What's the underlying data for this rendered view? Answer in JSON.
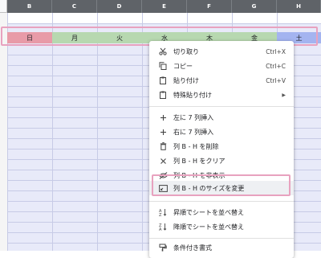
{
  "columns": [
    "B",
    "C",
    "D",
    "E",
    "F",
    "G",
    "H"
  ],
  "days": [
    {
      "label": "日",
      "kind": "sun"
    },
    {
      "label": "月",
      "kind": "wk"
    },
    {
      "label": "火",
      "kind": "wk"
    },
    {
      "label": "水",
      "kind": "wk"
    },
    {
      "label": "木",
      "kind": "wk"
    },
    {
      "label": "金",
      "kind": "wk"
    },
    {
      "label": "土",
      "kind": "sat"
    }
  ],
  "colors": {
    "column_header": "#5f6368",
    "selection": "#e8eaf9",
    "sunday": "#e89ba8",
    "weekday": "#b7d8b0",
    "saturday": "#a4b4f0",
    "highlight_frame": "#e8a2bf"
  },
  "menu": {
    "cut": {
      "label": "切り取り",
      "shortcut": "Ctrl+X",
      "icon": "scissors-icon"
    },
    "copy": {
      "label": "コピー",
      "shortcut": "Ctrl+C",
      "icon": "copy-icon"
    },
    "paste": {
      "label": "貼り付け",
      "shortcut": "Ctrl+V",
      "icon": "clipboard-icon"
    },
    "paste_special": {
      "label": "特殊貼り付け",
      "icon": "clipboard-icon"
    },
    "insert_left": {
      "label": "左に 7 列挿入",
      "icon": "plus-icon"
    },
    "insert_right": {
      "label": "右に 7 列挿入",
      "icon": "plus-icon"
    },
    "delete_cols": {
      "label": "列 B - H を削除",
      "icon": "trash-icon"
    },
    "clear_cols": {
      "label": "列 B - H をクリア",
      "icon": "close-icon"
    },
    "hide_cols": {
      "label": "列 B - H を非表示",
      "icon": "eye-off-icon"
    },
    "resize_cols": {
      "label": "列 B - H のサイズを変更",
      "icon": "resize-icon"
    },
    "sort_asc": {
      "label": "昇順でシートを並べ替え",
      "icon": "sort-az-icon"
    },
    "sort_desc": {
      "label": "降順でシートを並べ替え",
      "icon": "sort-za-icon"
    },
    "conditional_format": {
      "label": "条件付き書式",
      "icon": "paint-icon"
    }
  }
}
